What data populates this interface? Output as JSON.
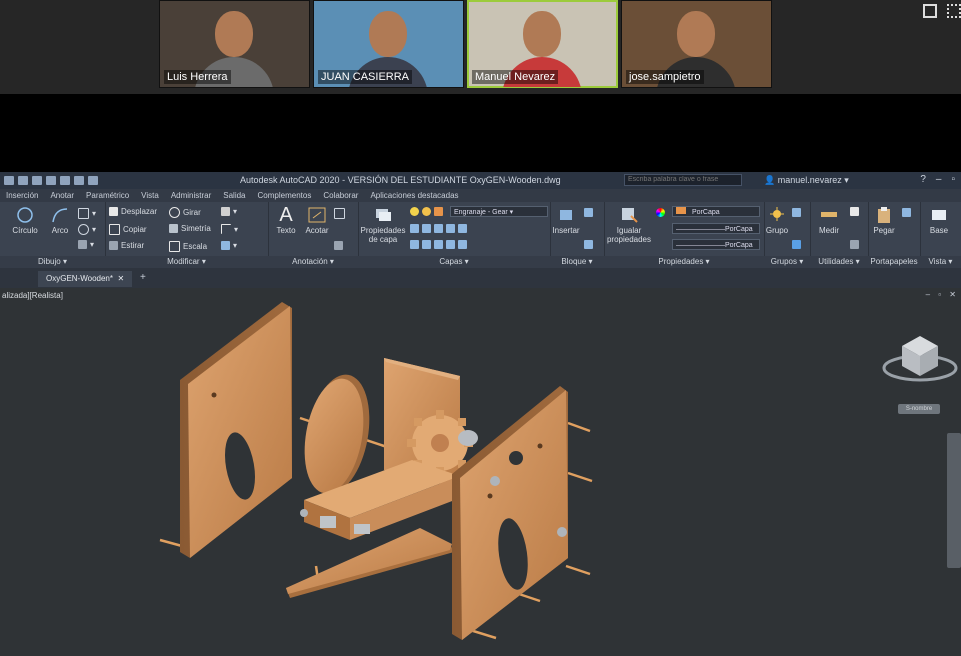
{
  "meeting": {
    "participants": [
      {
        "name": "Luis Herrera",
        "bg": "#4a4038",
        "shirt": "#6b6b6b"
      },
      {
        "name": "JUAN CASIERRA",
        "bg": "#5b8fb5",
        "shirt": "#3b4150"
      },
      {
        "name": "Manuel Nevarez",
        "bg": "#c9c3b4",
        "shirt": "#c73a3a"
      },
      {
        "name": "jose.sampietro",
        "bg": "#6b4f37",
        "shirt": "#2e2e2e"
      }
    ]
  },
  "app": {
    "title": "Autodesk AutoCAD 2020 - VERSIÓN DEL ESTUDIANTE    OxyGEN-Wooden.dwg",
    "search_placeholder": "Escriba palabra clave o frase",
    "user": "manuel.nevarez",
    "menu": [
      "Inserción",
      "Anotar",
      "Paramétrico",
      "Vista",
      "Administrar",
      "Salida",
      "Complementos",
      "Colaborar",
      "Aplicaciones destacadas"
    ],
    "accent": "#5aa0e6"
  },
  "ribbon": {
    "dibujo": {
      "label": "Dibujo",
      "circulo": "Círculo",
      "arco": "Arco"
    },
    "modificar": {
      "label": "Modificar",
      "desplazar": "Desplazar",
      "girar": "Girar",
      "copiar": "Copiar",
      "simetria": "Simetría",
      "estirar": "Estirar",
      "escala": "Escala"
    },
    "anotacion": {
      "label": "Anotación",
      "texto": "Texto",
      "acotar": "Acotar"
    },
    "capas": {
      "label": "Capas",
      "propiedades": "Propiedades",
      "de_capa": "de capa",
      "layer_value": "Engranaje - Gear"
    },
    "bloque": {
      "label": "Bloque",
      "insertar": "Insertar"
    },
    "propiedades": {
      "label": "Propiedades",
      "igualar": "Igualar",
      "propiedades_word": "propiedades",
      "color_value": "PorCapa",
      "linetype_value": "PorCapa",
      "lineweight_value": "PorCapa"
    },
    "grupos": {
      "label": "Grupos",
      "grupo": "Grupo"
    },
    "utilidades": {
      "label": "Utilidades",
      "medir": "Medir"
    },
    "portapapeles": {
      "label": "Portapapeles",
      "pegar": "Pegar"
    },
    "vista": {
      "label": "Vista",
      "base": "Base"
    }
  },
  "document": {
    "tab": "OxyGEN-Wooden*",
    "viewport_label": "alizada][Realista]",
    "viewcube_label": "S-nombre"
  },
  "colors": {
    "wood": "#c98d5a",
    "wood_dark": "#8a5a33",
    "wood_light": "#e2aa74"
  }
}
